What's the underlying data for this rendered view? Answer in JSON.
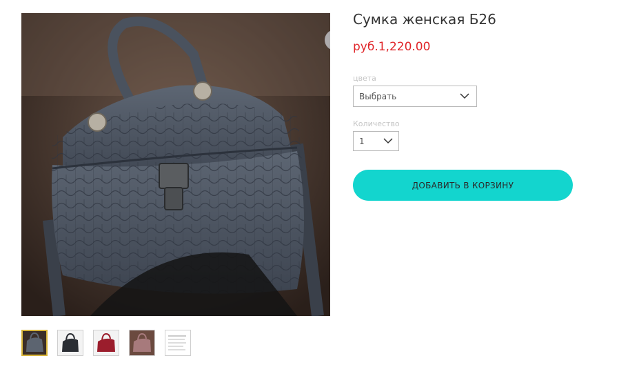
{
  "product": {
    "title": "Сумка женская Б26",
    "price": "руб.1,220.00"
  },
  "options": {
    "color_label": "цвета",
    "color_value": "Выбрать",
    "quantity_label": "Количество",
    "quantity_value": "1"
  },
  "actions": {
    "add_to_cart": "ДОБАВИТЬ В КОРЗИНУ"
  },
  "gallery": {
    "thumbnails": [
      "gray-bag",
      "black-bag",
      "red-bag",
      "pink-bag",
      "size-chart"
    ],
    "active_index": 0
  },
  "colors": {
    "accent": "#13d5ce",
    "price": "#e0262a"
  }
}
